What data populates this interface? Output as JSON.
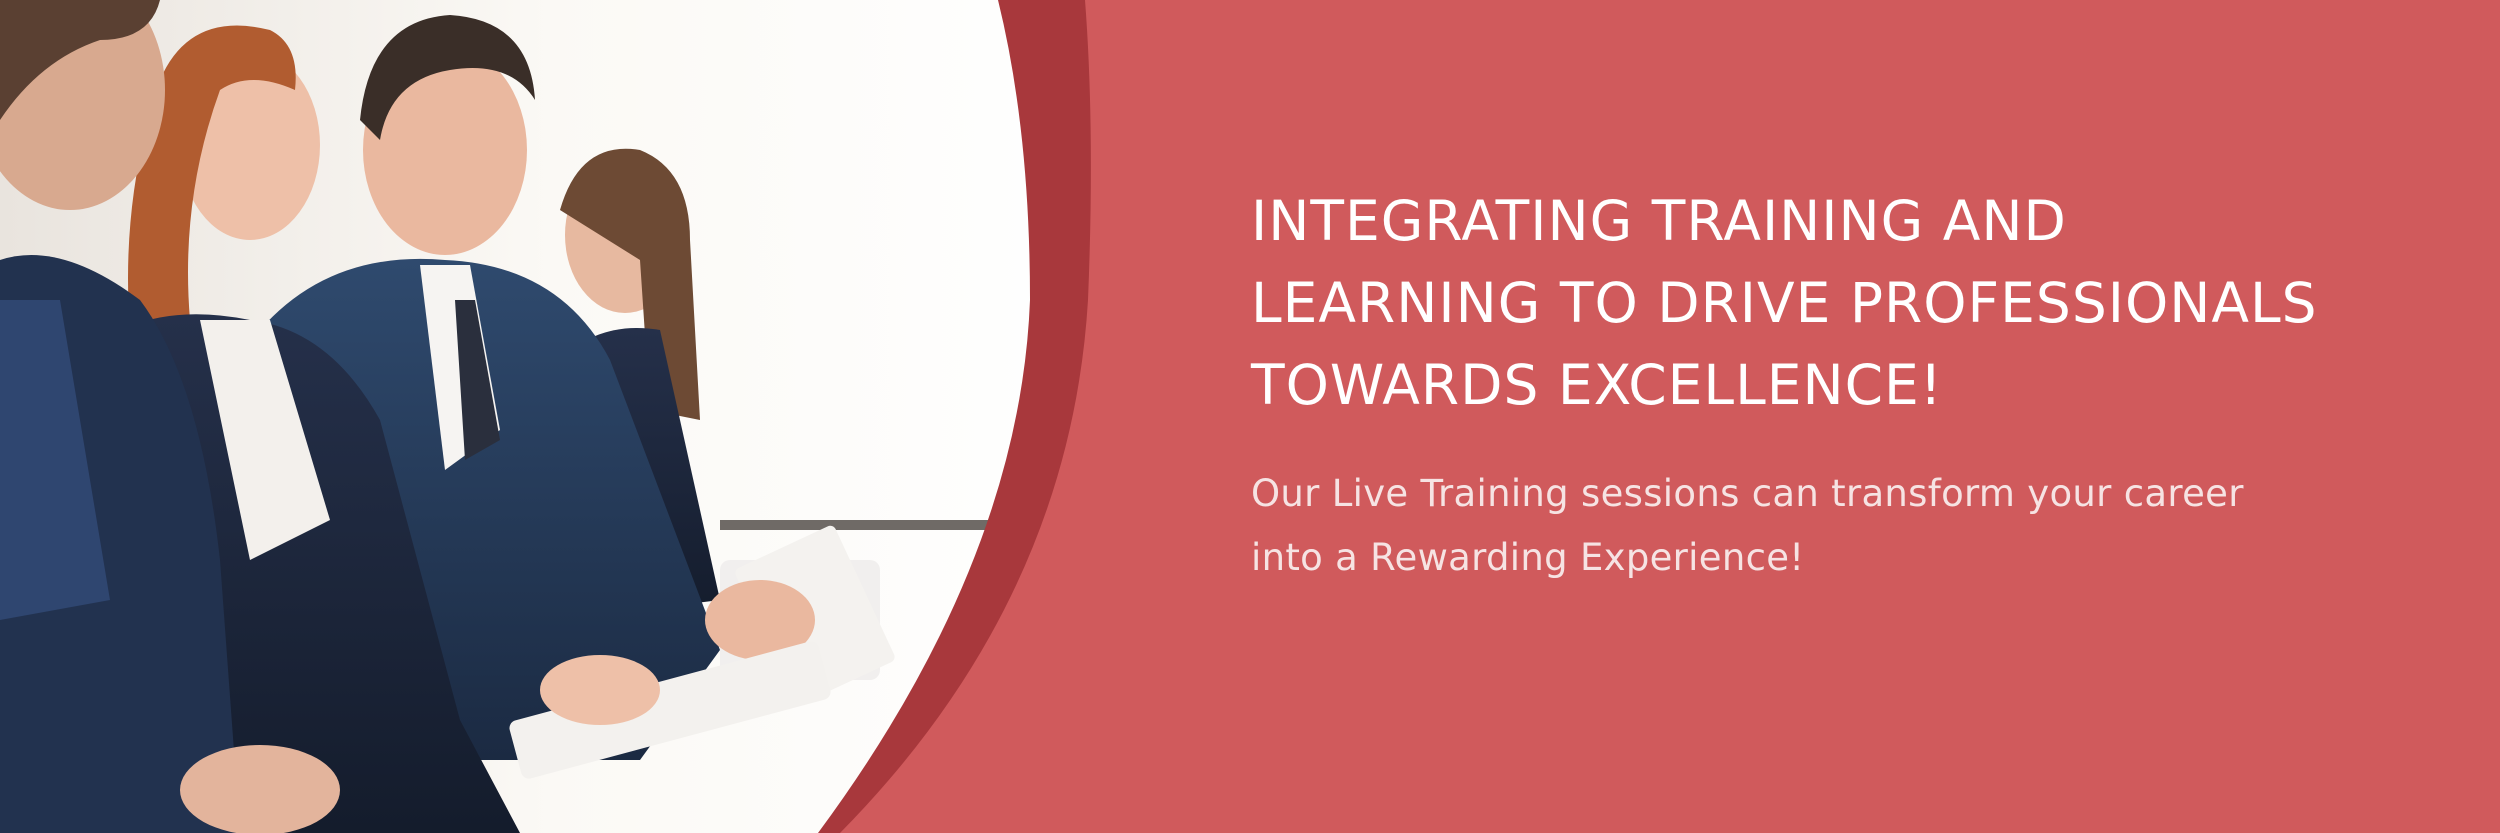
{
  "banner": {
    "headline_lines": [
      "INTEGRATING TRAINING AND",
      "LEARNING TO DRIVE PROFESSIONALS",
      "TOWARDS EXCELLENCE!"
    ],
    "subtext_lines": [
      "Our Live Training sessions can transform your career",
      "into a Rewarding Experience!"
    ],
    "colors": {
      "panel": "#d05a5c",
      "panel_edge": "#a8383c",
      "text": "#ffffff"
    }
  }
}
